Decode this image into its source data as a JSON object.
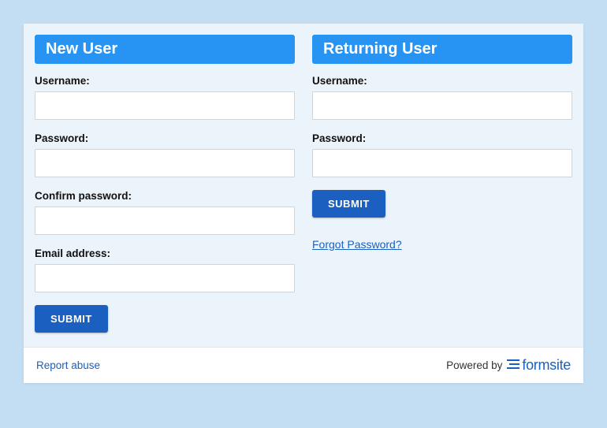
{
  "newUser": {
    "title": "New User",
    "usernameLabel": "Username:",
    "passwordLabel": "Password:",
    "confirmLabel": "Confirm password:",
    "emailLabel": "Email address:",
    "submit": "SUBMIT"
  },
  "returningUser": {
    "title": "Returning User",
    "usernameLabel": "Username:",
    "passwordLabel": "Password:",
    "submit": "SUBMIT",
    "forgot": "Forgot Password?"
  },
  "footer": {
    "report": "Report abuse",
    "poweredBy": "Powered by",
    "brand": "formsite"
  }
}
